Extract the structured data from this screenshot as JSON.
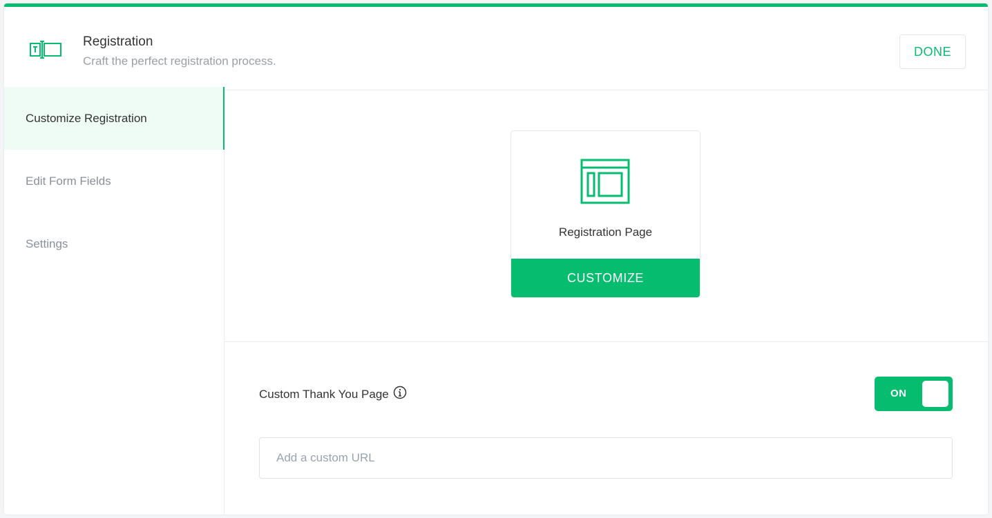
{
  "header": {
    "title": "Registration",
    "subtitle": "Craft the perfect registration process.",
    "done_label": "DONE",
    "icon": "registration-icon"
  },
  "sidebar": {
    "items": [
      {
        "label": "Customize Registration",
        "active": true
      },
      {
        "label": "Edit Form Fields",
        "active": false
      },
      {
        "label": "Settings",
        "active": false
      }
    ]
  },
  "main": {
    "card": {
      "label": "Registration Page",
      "button_label": "CUSTOMIZE",
      "icon": "page-layout-icon"
    },
    "thank_you": {
      "label": "Custom Thank You Page",
      "info_icon": "info-icon",
      "toggle_label": "ON",
      "toggle_on": true,
      "url_placeholder": "Add a custom URL",
      "url_value": ""
    }
  },
  "colors": {
    "accent": "#06bd6f",
    "active_bg": "#effcf6",
    "muted_text": "#9aa0a6"
  }
}
